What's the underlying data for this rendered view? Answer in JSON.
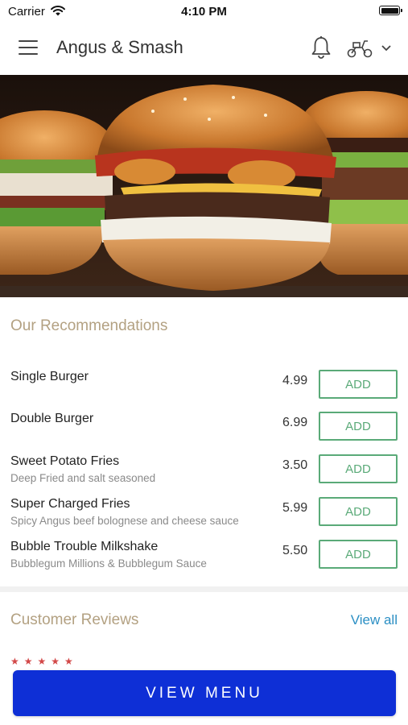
{
  "status_bar": {
    "carrier": "Carrier",
    "time": "4:10 PM"
  },
  "header": {
    "title": "Angus & Smash"
  },
  "recommendations": {
    "title": "Our Recommendations",
    "items": [
      {
        "name": "Single Burger",
        "description": "",
        "price": "4.99",
        "button": "ADD"
      },
      {
        "name": "Double Burger",
        "description": "",
        "price": "6.99",
        "button": "ADD"
      },
      {
        "name": "Sweet Potato Fries",
        "description": "Deep Fried and salt seasoned",
        "price": "3.50",
        "button": "ADD"
      },
      {
        "name": "Super Charged Fries",
        "description": "Spicy Angus beef bolognese and cheese sauce",
        "price": "5.99",
        "button": "ADD"
      },
      {
        "name": "Bubble Trouble Milkshake",
        "description": "Bubblegum Millions & Bubblegum Sauce",
        "price": "5.50",
        "button": "ADD"
      }
    ]
  },
  "reviews": {
    "title": "Customer Reviews",
    "view_all": "View all",
    "stars": "★★★★★"
  },
  "cta": {
    "view_menu": "VIEW MENU"
  },
  "colors": {
    "accent_green": "#5aaa78",
    "cta_blue": "#0e2fd6",
    "section_title": "#b3a182",
    "link_blue": "#2b8fc4"
  },
  "icons": [
    "wifi-icon",
    "battery-icon",
    "menu-icon",
    "bell-icon",
    "scooter-icon",
    "chevron-down-icon"
  ]
}
